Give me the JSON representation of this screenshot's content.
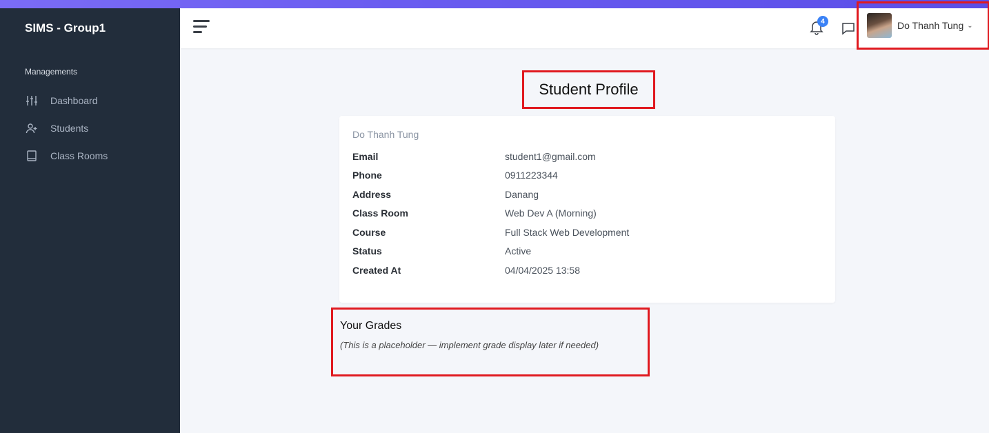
{
  "brand": "SIMS - Group1",
  "sidebar": {
    "section_label": "Managements",
    "items": [
      {
        "label": "Dashboard",
        "icon": "sliders-icon"
      },
      {
        "label": "Students",
        "icon": "user-plus-icon"
      },
      {
        "label": "Class Rooms",
        "icon": "book-icon"
      }
    ]
  },
  "topbar": {
    "notification_count": "4",
    "user_name": "Do Thanh Tung",
    "caret": "⌄"
  },
  "page": {
    "title": "Student Profile"
  },
  "profile": {
    "name": "Do Thanh Tung",
    "fields": [
      {
        "label": "Email",
        "value": "student1@gmail.com"
      },
      {
        "label": "Phone",
        "value": "0911223344"
      },
      {
        "label": "Address",
        "value": "Danang"
      },
      {
        "label": "Class Room",
        "value": "Web Dev A (Morning)"
      },
      {
        "label": "Course",
        "value": "Full Stack Web Development"
      },
      {
        "label": "Status",
        "value": "Active"
      },
      {
        "label": "Created At",
        "value": "04/04/2025 13:58"
      }
    ]
  },
  "grades": {
    "title": "Your Grades",
    "note": "(This is a placeholder — implement grade display later if needed)"
  },
  "colors": {
    "sidebar_bg": "#222d3b",
    "highlight_border": "#e0191f",
    "badge": "#3b82f6",
    "page_bg": "#f4f6fa"
  }
}
